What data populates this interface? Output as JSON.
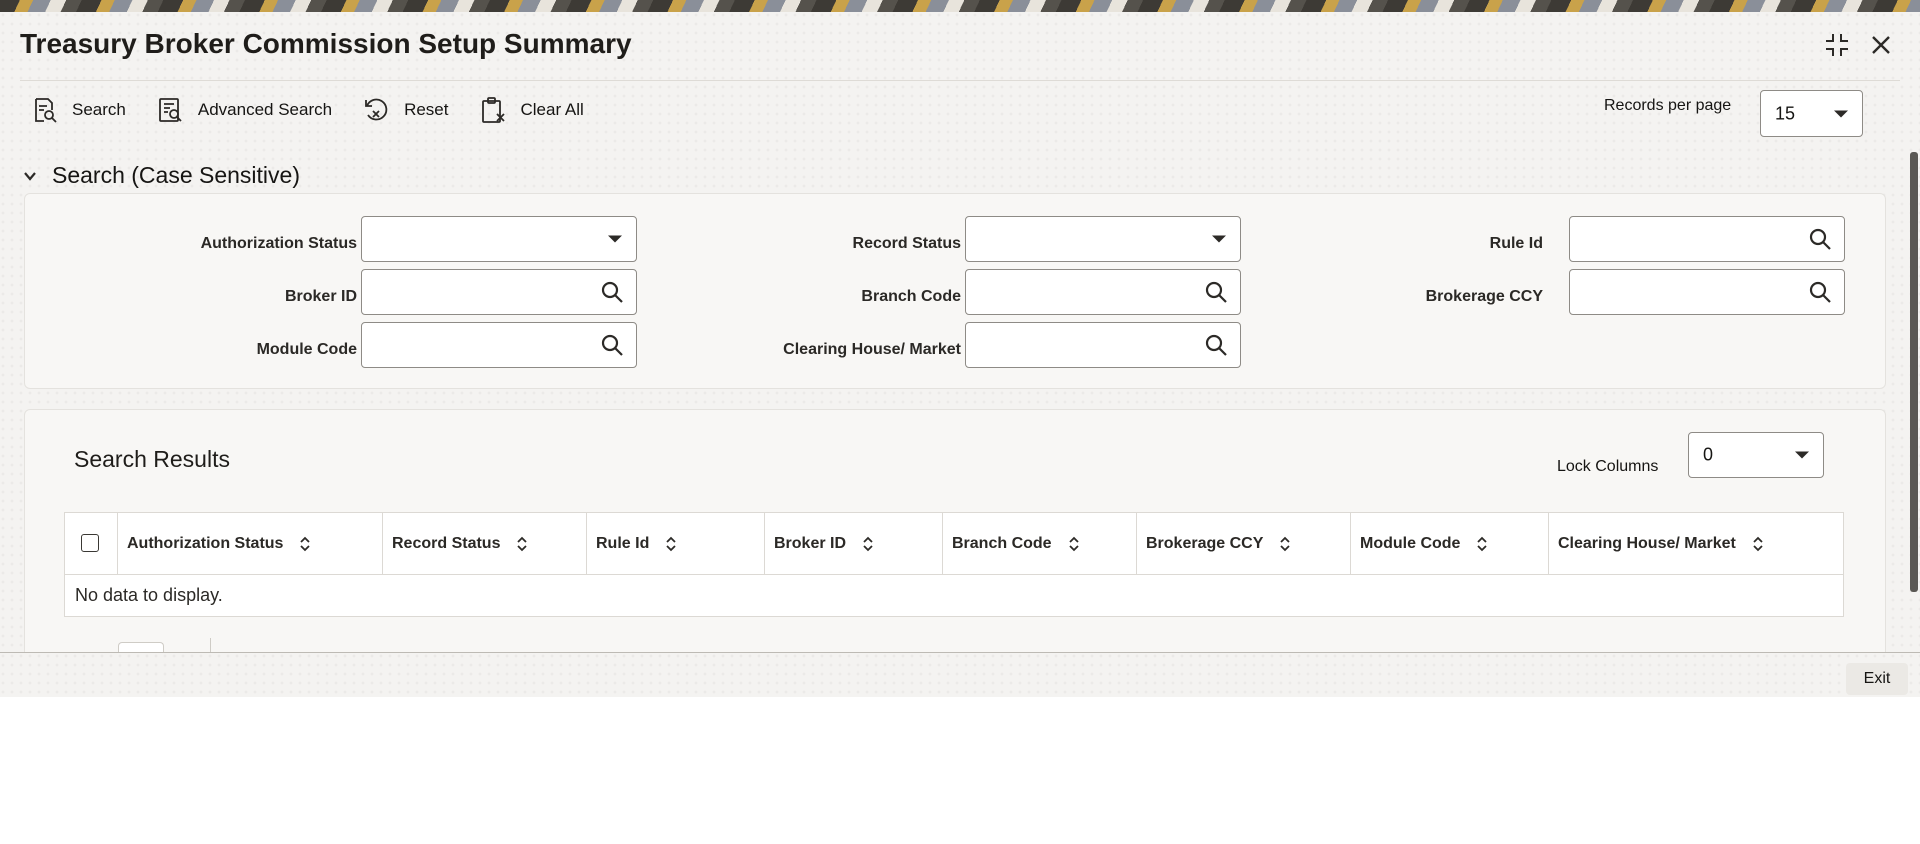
{
  "window": {
    "title": "Treasury Broker Commission Setup Summary",
    "controls": [
      "collapse-icon",
      "close-icon"
    ]
  },
  "toolbar": {
    "search_label": "Search",
    "advanced_search_label": "Advanced Search",
    "reset_label": "Reset",
    "clear_all_label": "Clear All",
    "records_per_page_label": "Records per page",
    "records_per_page_value": "15"
  },
  "search_section": {
    "heading": "Search (Case Sensitive)",
    "fields": {
      "authorization_status": {
        "label": "Authorization Status",
        "value": "",
        "type": "select"
      },
      "record_status": {
        "label": "Record Status",
        "value": "",
        "type": "select"
      },
      "rule_id": {
        "label": "Rule Id",
        "value": "",
        "type": "lov"
      },
      "broker_id": {
        "label": "Broker ID",
        "value": "",
        "type": "lov"
      },
      "branch_code": {
        "label": "Branch Code",
        "value": "",
        "type": "lov"
      },
      "brokerage_ccy": {
        "label": "Brokerage CCY",
        "value": "",
        "type": "lov"
      },
      "module_code": {
        "label": "Module Code",
        "value": "",
        "type": "lov"
      },
      "clearing_house": {
        "label": "Clearing House/ Market",
        "value": "",
        "type": "lov"
      }
    }
  },
  "results": {
    "heading": "Search Results",
    "lock_columns_label": "Lock Columns",
    "lock_columns_value": "0",
    "columns": [
      "Authorization Status",
      "Record Status",
      "Rule Id",
      "Broker ID",
      "Branch Code",
      "Brokerage CCY",
      "Module Code",
      "Clearing House/ Market"
    ],
    "empty_message": "No data to display."
  },
  "footer": {
    "exit_label": "Exit"
  },
  "colors": {
    "background": "#f4f3f1",
    "panel": "#f8f7f5",
    "text": "#161513",
    "border": "#8e8b86"
  }
}
